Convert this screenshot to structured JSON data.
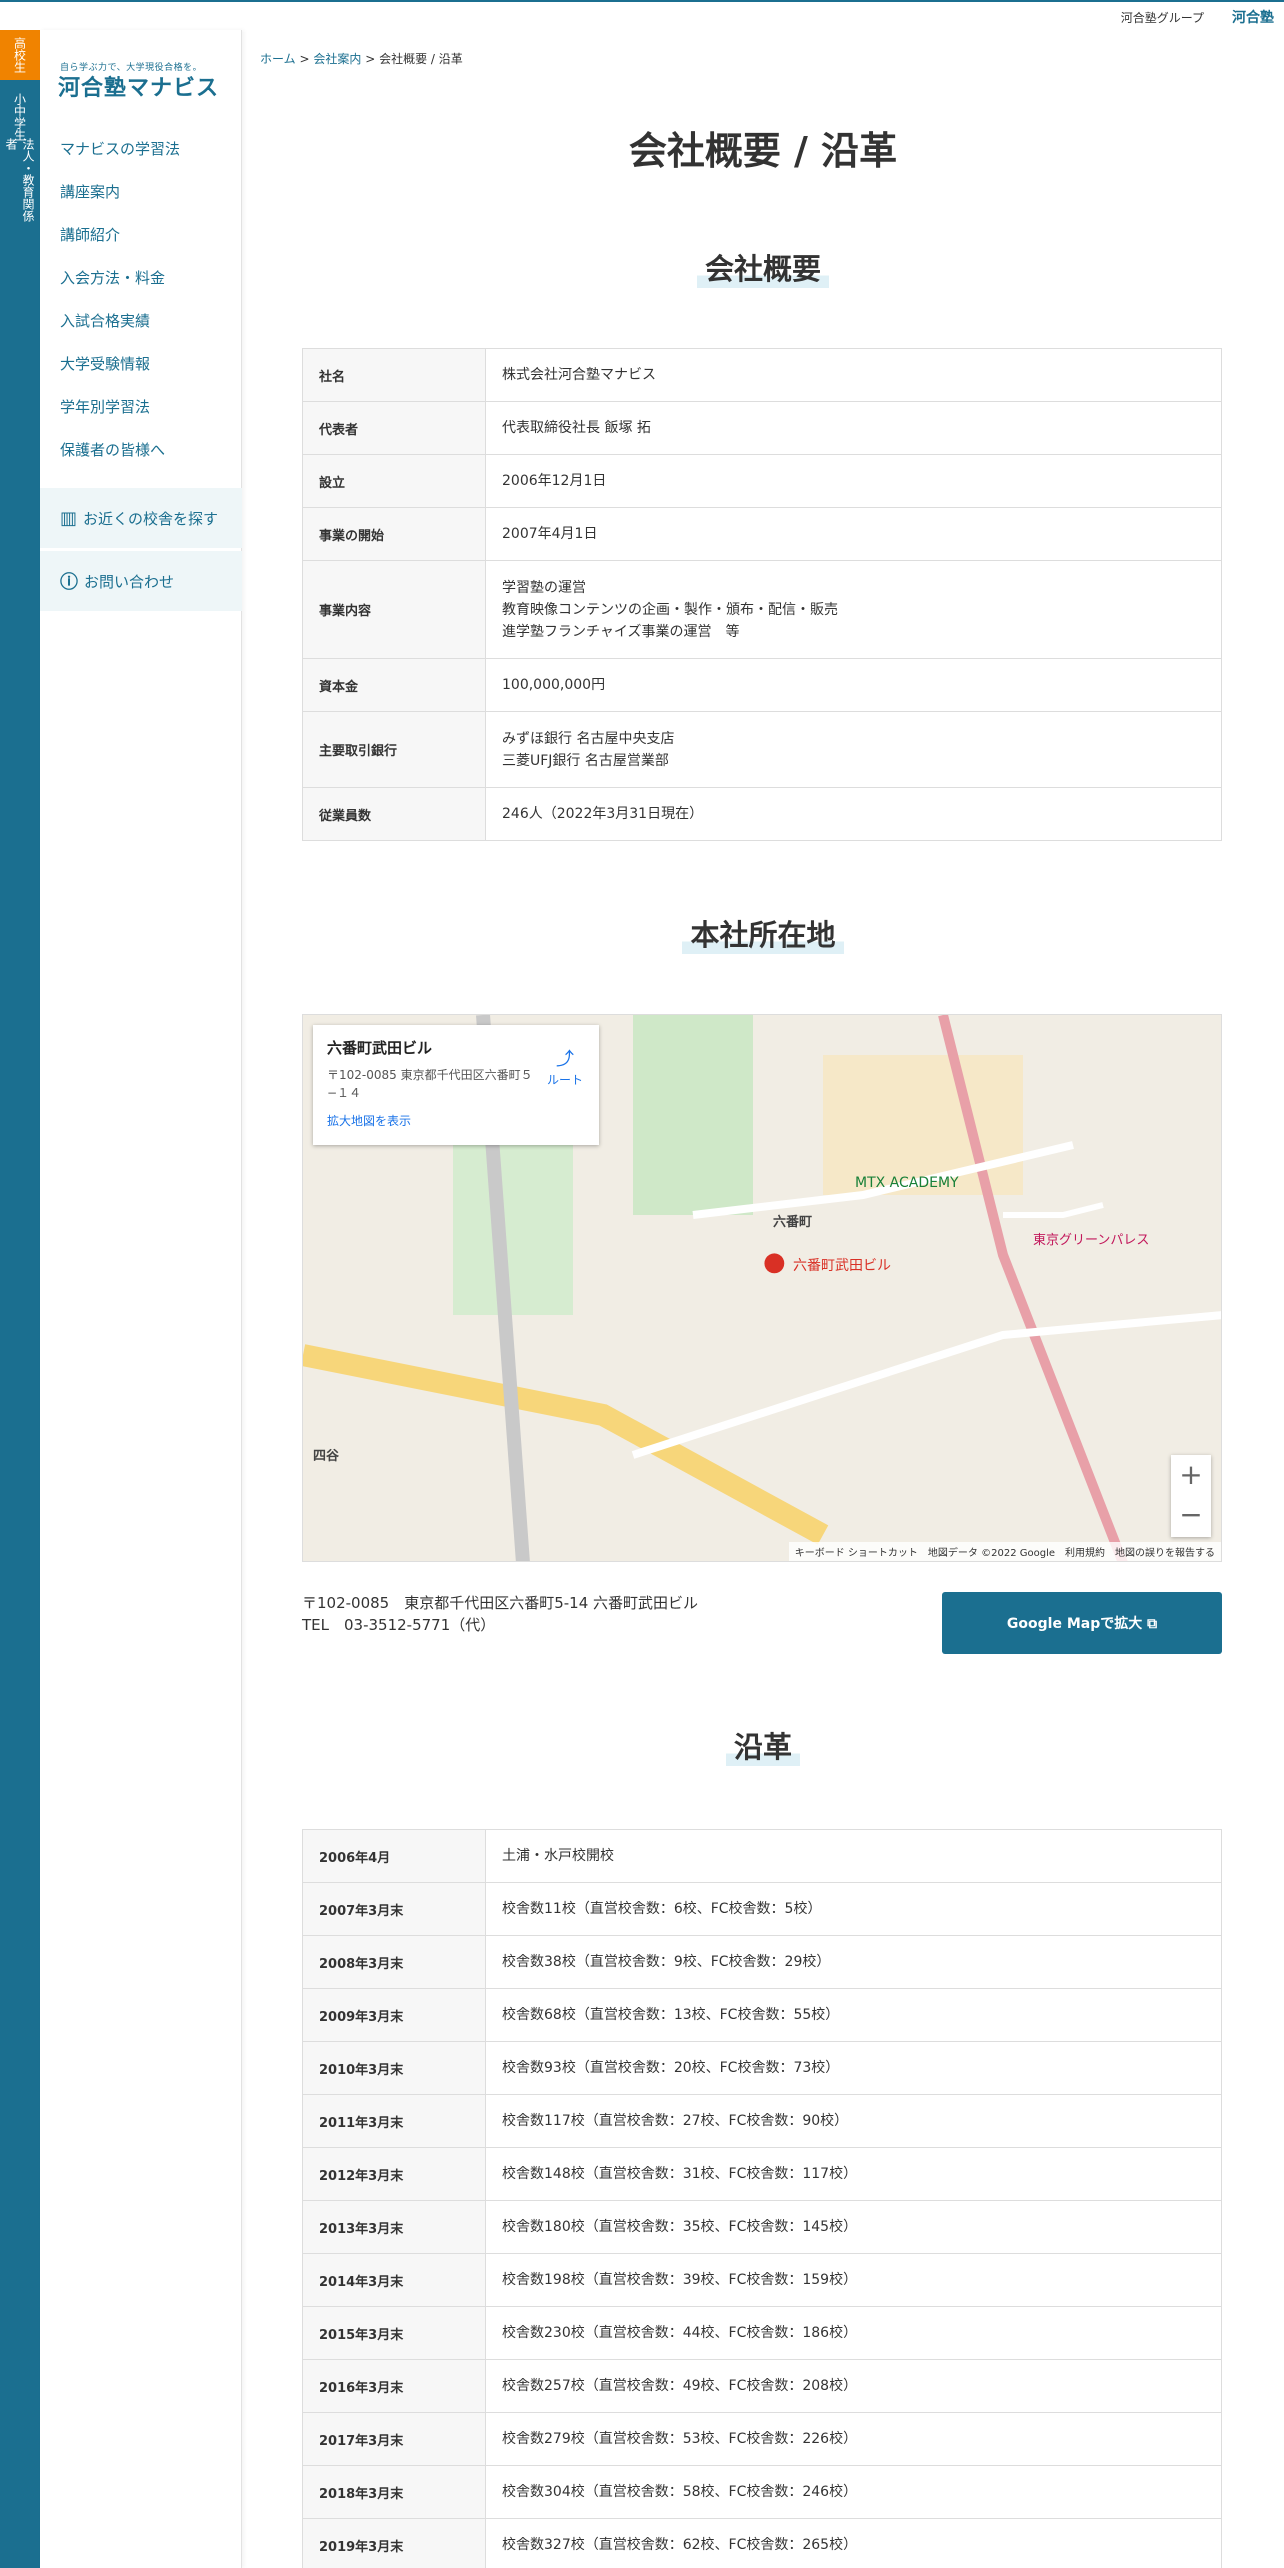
{
  "topbar": {
    "group_label": "河合塾グループ",
    "logo_text": "河合塾"
  },
  "vertical_tabs": [
    {
      "label": "高校生"
    },
    {
      "label": "小中学生"
    },
    {
      "label": "法人・教育関係者"
    }
  ],
  "sidebar": {
    "tagline": "自ら学ぶ力で、大学現役合格を。",
    "brand": "河合塾マナビス",
    "nav": [
      {
        "label": "マナビスの学習法"
      },
      {
        "label": "講座案内"
      },
      {
        "label": "講師紹介"
      },
      {
        "label": "入会方法・料金"
      },
      {
        "label": "入試合格実績"
      },
      {
        "label": "大学受験情報"
      },
      {
        "label": "学年別学習法"
      },
      {
        "label": "保護者の皆様へ"
      }
    ],
    "find_school": "お近くの校舎を探す",
    "contact": "お問い合わせ"
  },
  "breadcrumb": {
    "home": "ホーム",
    "sep1": ">",
    "company": "会社案内",
    "sep2": ">",
    "current": "会社概要 / 沿革"
  },
  "page_title": "会社概要 / 沿革",
  "overview": {
    "heading": "会社概要",
    "rows": [
      {
        "label": "社名",
        "value": "株式会社河合塾マナビス"
      },
      {
        "label": "代表者",
        "value": "代表取締役社長 飯塚 拓"
      },
      {
        "label": "設立",
        "value": "2006年12月1日"
      },
      {
        "label": "事業の開始",
        "value": "2007年4月1日"
      },
      {
        "label": "事業内容",
        "value": "学習塾の運営\n教育映像コンテンツの企画・製作・頒布・配信・販売\n進学塾フランチャイズ事業の運営　等"
      },
      {
        "label": "資本金",
        "value": "100,000,000円"
      },
      {
        "label": "主要取引銀行",
        "value": "みずほ銀行 名古屋中央支店\n三菱UFJ銀行 名古屋営業部"
      },
      {
        "label": "従業員数",
        "value": "246人（2022年3月31日現在）"
      }
    ]
  },
  "location": {
    "heading": "本社所在地",
    "map_card": {
      "name": "六番町武田ビル",
      "address": "〒102-0085 東京都千代田区六番町５−１４",
      "link": "拡大地図を表示",
      "route": "ルート"
    },
    "map_labels": {
      "pin": "六番町武田ビル",
      "academy": "MTX ACADEMY",
      "area": "六番町",
      "station": "四谷",
      "palace": "東京グリーンパレス"
    },
    "map_footer": "キーボード ショートカット　地図データ ©2022 Google　利用規約　地図の誤りを報告する",
    "address_line1": "〒102-0085　東京都千代田区六番町5-14 六番町武田ビル",
    "address_line2": "TEL　03-3512-5771（代）",
    "gmap_button": "Google Mapで拡大 ⧉"
  },
  "history": {
    "heading": "沿革",
    "rows": [
      {
        "label": "2006年4月",
        "value": "土浦・水戸校開校"
      },
      {
        "label": "2007年3月末",
        "value": "校舎数11校（直営校舎数：6校、FC校舎数：5校）"
      },
      {
        "label": "2008年3月末",
        "value": "校舎数38校（直営校舎数：9校、FC校舎数：29校）"
      },
      {
        "label": "2009年3月末",
        "value": "校舎数68校（直営校舎数：13校、FC校舎数：55校）"
      },
      {
        "label": "2010年3月末",
        "value": "校舎数93校（直営校舎数：20校、FC校舎数：73校）"
      },
      {
        "label": "2011年3月末",
        "value": "校舎数117校（直営校舎数：27校、FC校舎数：90校）"
      },
      {
        "label": "2012年3月末",
        "value": "校舎数148校（直営校舎数：31校、FC校舎数：117校）"
      },
      {
        "label": "2013年3月末",
        "value": "校舎数180校（直営校舎数：35校、FC校舎数：145校）"
      },
      {
        "label": "2014年3月末",
        "value": "校舎数198校（直営校舎数：39校、FC校舎数：159校）"
      },
      {
        "label": "2015年3月末",
        "value": "校舎数230校（直営校舎数：44校、FC校舎数：186校）"
      },
      {
        "label": "2016年3月末",
        "value": "校舎数257校（直営校舎数：49校、FC校舎数：208校）"
      },
      {
        "label": "2017年3月末",
        "value": "校舎数279校（直営校舎数：53校、FC校舎数：226校）"
      },
      {
        "label": "2018年3月末",
        "value": "校舎数304校（直営校舎数：58校、FC校舎数：246校）"
      },
      {
        "label": "2019年3月末",
        "value": "校舎数327校（直営校舎数：62校、FC校舎数：265校）"
      }
    ]
  }
}
